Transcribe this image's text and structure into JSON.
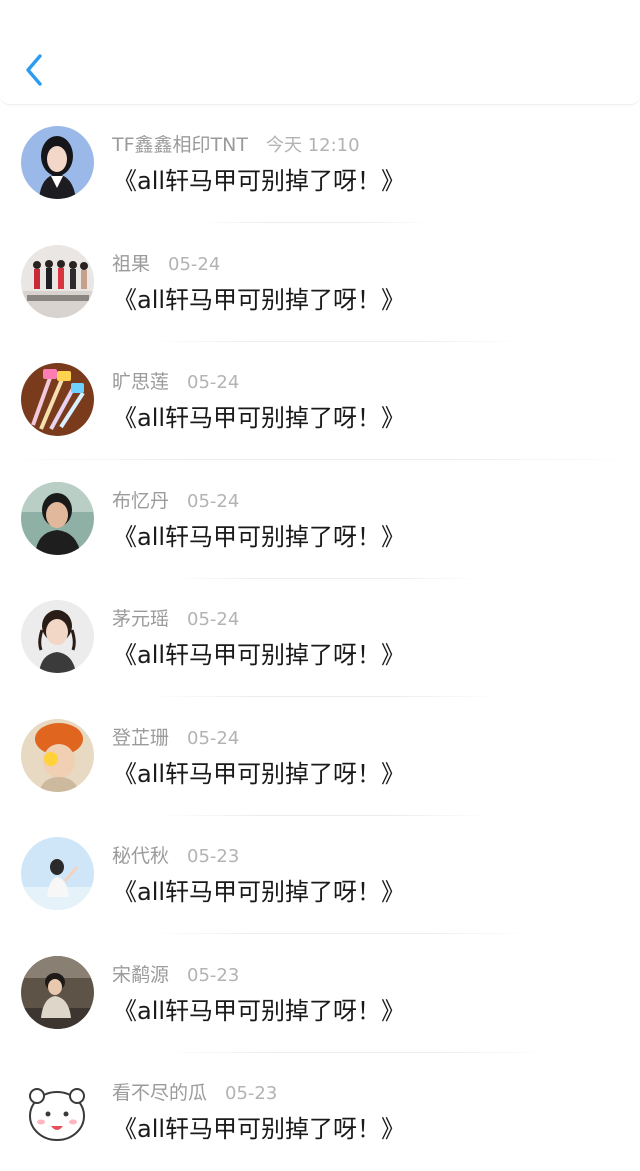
{
  "header": {
    "back_icon": "chevron-left-icon",
    "accent_color": "#2b9cf0"
  },
  "comments": [
    {
      "name": "TF鑫鑫相印TNT",
      "time": "今天 12:10",
      "text": "《all轩马甲可别掉了呀！》",
      "avatar": "girl-portrait"
    },
    {
      "name": "祖果",
      "time": "05-24",
      "text": "《all轩马甲可别掉了呀！》",
      "avatar": "group-photo"
    },
    {
      "name": "旷思莲",
      "time": "05-24",
      "text": "《all轩马甲可别掉了呀！》",
      "avatar": "pens"
    },
    {
      "name": "布忆丹",
      "time": "05-24",
      "text": "《all轩马甲可别掉了呀！》",
      "avatar": "woman-portrait"
    },
    {
      "name": "茅元瑶",
      "time": "05-24",
      "text": "《all轩马甲可别掉了呀！》",
      "avatar": "child-portrait"
    },
    {
      "name": "登芷珊",
      "time": "05-24",
      "text": "《all轩马甲可别掉了呀！》",
      "avatar": "orange-hat"
    },
    {
      "name": "秘代秋",
      "time": "05-23",
      "text": "《all轩马甲可别掉了呀！》",
      "avatar": "sky-portrait"
    },
    {
      "name": "宋鹬源",
      "time": "05-23",
      "text": "《all轩马甲可别掉了呀！》",
      "avatar": "outdoor-portrait"
    },
    {
      "name": "看不尽的瓜",
      "time": "05-23",
      "text": "《all轩马甲可别掉了呀！》",
      "avatar": "cartoon-bear"
    }
  ]
}
